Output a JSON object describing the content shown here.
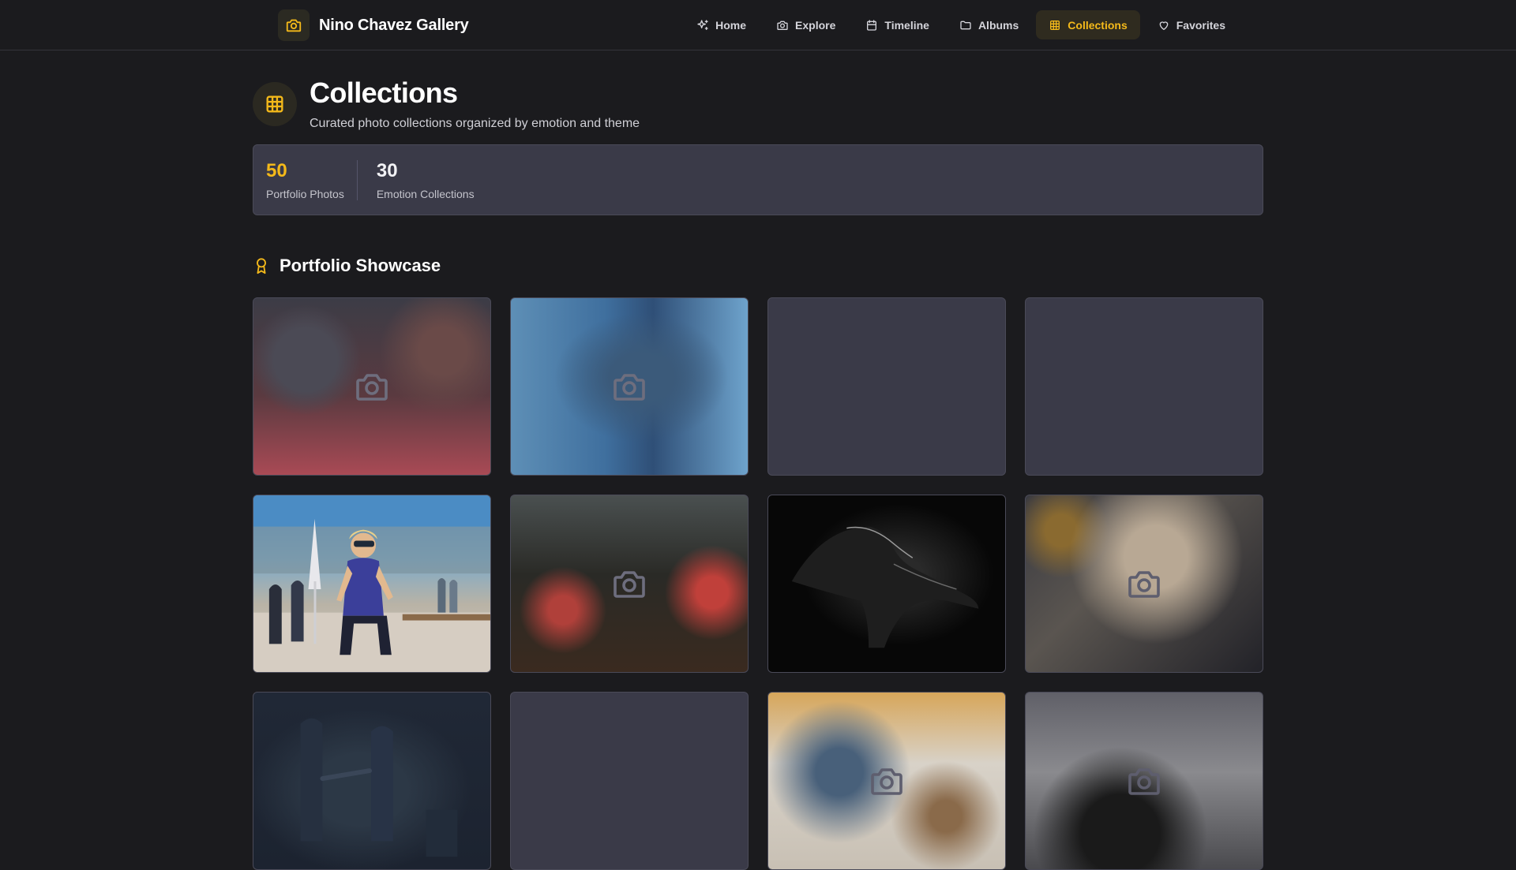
{
  "app": {
    "title": "Nino Chavez Gallery"
  },
  "nav": {
    "items": [
      {
        "label": "Home",
        "icon": "sparkles-icon",
        "active": false
      },
      {
        "label": "Explore",
        "icon": "camera-icon",
        "active": false
      },
      {
        "label": "Timeline",
        "icon": "calendar-icon",
        "active": false
      },
      {
        "label": "Albums",
        "icon": "folder-icon",
        "active": false
      },
      {
        "label": "Collections",
        "icon": "grid-icon",
        "active": true
      },
      {
        "label": "Favorites",
        "icon": "heart-icon",
        "active": false
      }
    ]
  },
  "page": {
    "title": "Collections",
    "subtitle": "Curated photo collections organized by emotion and theme",
    "icon": "grid-icon"
  },
  "stats": [
    {
      "value": "50",
      "label": "Portfolio Photos"
    },
    {
      "value": "30",
      "label": "Emotion Collections"
    }
  ],
  "section": {
    "title": "Portfolio Showcase",
    "icon": "award-icon"
  },
  "colors": {
    "accent": "#f4b91a",
    "background": "#1b1b1e",
    "card": "#3a3a48"
  },
  "tiles": [
    {
      "state": "loading-placeholder"
    },
    {
      "state": "loading-placeholder"
    },
    {
      "state": "empty"
    },
    {
      "state": "empty"
    },
    {
      "state": "loaded"
    },
    {
      "state": "loading-placeholder"
    },
    {
      "state": "loaded"
    },
    {
      "state": "loading-placeholder"
    },
    {
      "state": "loaded"
    },
    {
      "state": "empty"
    },
    {
      "state": "loading-placeholder"
    },
    {
      "state": "loading-placeholder"
    }
  ]
}
